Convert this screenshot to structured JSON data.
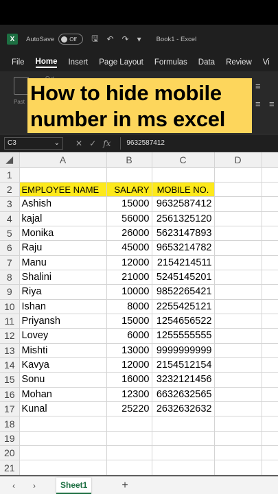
{
  "titlebar": {
    "app_logo": "X",
    "autosave_label": "AutoSave",
    "autosave_state": "Off",
    "doc_title": "Book1  -  Excel"
  },
  "menu": [
    "File",
    "Home",
    "Insert",
    "Page Layout",
    "Formulas",
    "Data",
    "Review",
    "Vi"
  ],
  "ribbon": {
    "paste_label": "Past",
    "cut_label": "Cut"
  },
  "overlay": {
    "line1": "How to hide mobile",
    "line2": "number in ms excel"
  },
  "formula_bar": {
    "cell_ref": "C3",
    "formula": "9632587412"
  },
  "sheet": {
    "columns": [
      "A",
      "B",
      "C",
      "D"
    ],
    "row_numbers": [
      "1",
      "2",
      "3",
      "4",
      "5",
      "6",
      "7",
      "8",
      "9",
      "10",
      "11",
      "12",
      "13",
      "14",
      "15",
      "16",
      "17",
      "18",
      "19",
      "20",
      "21"
    ],
    "headers": [
      "EMPLOYEE NAME",
      "SALARY",
      "MOBILE NO."
    ],
    "rows": [
      [
        "Ashish",
        "15000",
        "9632587412"
      ],
      [
        "kajal",
        "56000",
        "2561325120"
      ],
      [
        "Monika",
        "26000",
        "5623147893"
      ],
      [
        "Raju",
        "45000",
        "9653214782"
      ],
      [
        "Manu",
        "12000",
        "2154214511"
      ],
      [
        "Shalini",
        "21000",
        "5245145201"
      ],
      [
        "Riya",
        "10000",
        "9852265421"
      ],
      [
        "Ishan",
        "8000",
        "2255425121"
      ],
      [
        "Priyansh",
        "15000",
        "1254656522"
      ],
      [
        "Lovey",
        "6000",
        "1255555555"
      ],
      [
        "Mishti",
        "13000",
        "9999999999"
      ],
      [
        "Kavya",
        "12000",
        "2154512154"
      ],
      [
        "Sonu",
        "16000",
        "3232121456"
      ],
      [
        "Mohan",
        "12300",
        "6632632565"
      ],
      [
        "Kunal",
        "25220",
        "2632632632"
      ]
    ]
  },
  "tabs": {
    "active": "Sheet1",
    "add": "+"
  },
  "colors": {
    "header_fill": "#fde91b",
    "overlay_bg": "#fdd65c",
    "excel_green": "#1d6f42"
  }
}
